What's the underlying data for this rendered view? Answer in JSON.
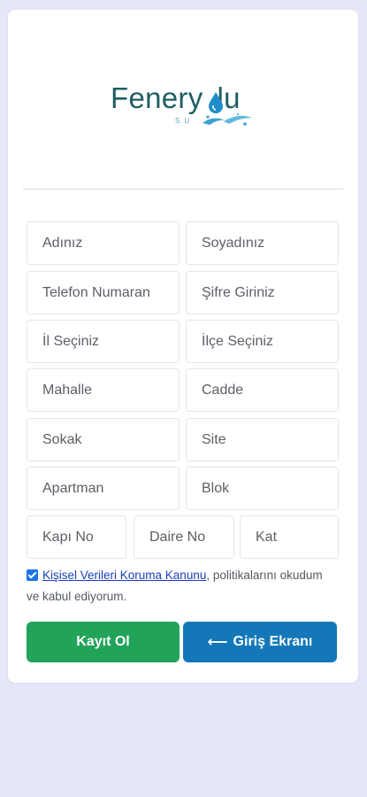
{
  "brand": {
    "name_part1": "Fenery",
    "name_part2": "lu",
    "subtitle": "SU"
  },
  "form": {
    "fields": [
      {
        "key": "first_name",
        "placeholder": "Adınız"
      },
      {
        "key": "last_name",
        "placeholder": "Soyadınız"
      },
      {
        "key": "phone",
        "placeholder": "Telefon Numaran"
      },
      {
        "key": "password",
        "placeholder": "Şifre Giriniz"
      },
      {
        "key": "province",
        "placeholder": "İl Seçiniz"
      },
      {
        "key": "district",
        "placeholder": "İlçe Seçiniz"
      },
      {
        "key": "neighborhood",
        "placeholder": "Mahalle"
      },
      {
        "key": "avenue",
        "placeholder": "Cadde"
      },
      {
        "key": "street",
        "placeholder": "Sokak"
      },
      {
        "key": "site",
        "placeholder": "Site"
      },
      {
        "key": "apartment",
        "placeholder": "Apartman"
      },
      {
        "key": "block",
        "placeholder": "Blok"
      },
      {
        "key": "door_no",
        "placeholder": "Kapı No"
      },
      {
        "key": "flat_no",
        "placeholder": "Daire No"
      },
      {
        "key": "floor",
        "placeholder": "Kat"
      }
    ]
  },
  "consent": {
    "checked": true,
    "link_text": "Kişisel Verileri Koruma Kanunu",
    "rest_text": ", politikalarını okudum ve kabul ediyorum."
  },
  "buttons": {
    "register_label": "Kayıt Ol",
    "login_arrow": "⟵",
    "login_label": "Giriş Ekranı"
  },
  "colors": {
    "background": "#e6e6f9",
    "register_button": "#22a35a",
    "login_button": "#1478b8",
    "brand_text": "#1f5d63",
    "link": "#1a3fc0"
  }
}
